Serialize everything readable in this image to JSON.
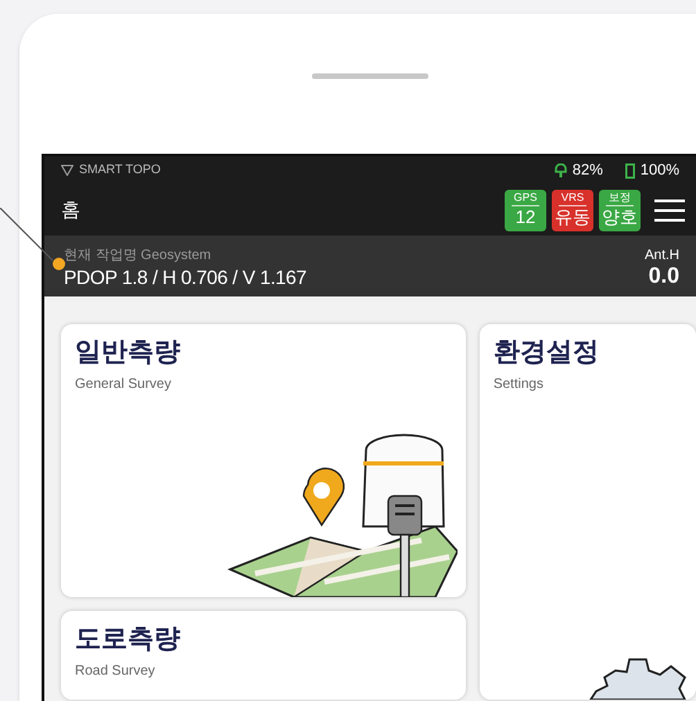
{
  "status_bar": {
    "app_name": "SMART TOPO",
    "receiver_battery": "82%",
    "phone_battery": "100%"
  },
  "header": {
    "title": "홈",
    "badges": [
      {
        "label": "GPS",
        "value": "12",
        "color": "#3aa844"
      },
      {
        "label": "VRS",
        "value": "유동",
        "color": "#d8312b"
      },
      {
        "label": "보정",
        "value": "양호",
        "color": "#3aa844"
      }
    ]
  },
  "info_bar": {
    "job_name": "현재 작업명 Geosystem",
    "precision": "PDOP 1.8 / H 0.706 / V 1.167",
    "ant_label": "Ant.H",
    "ant_value": "0.0"
  },
  "cards": [
    {
      "kind": "survey",
      "title": "일반측량",
      "subtitle": "General Survey"
    },
    {
      "kind": "settings",
      "title": "환경설정",
      "subtitle": "Settings"
    },
    {
      "kind": "road",
      "title": "도로측량",
      "subtitle": "Road Survey"
    }
  ]
}
